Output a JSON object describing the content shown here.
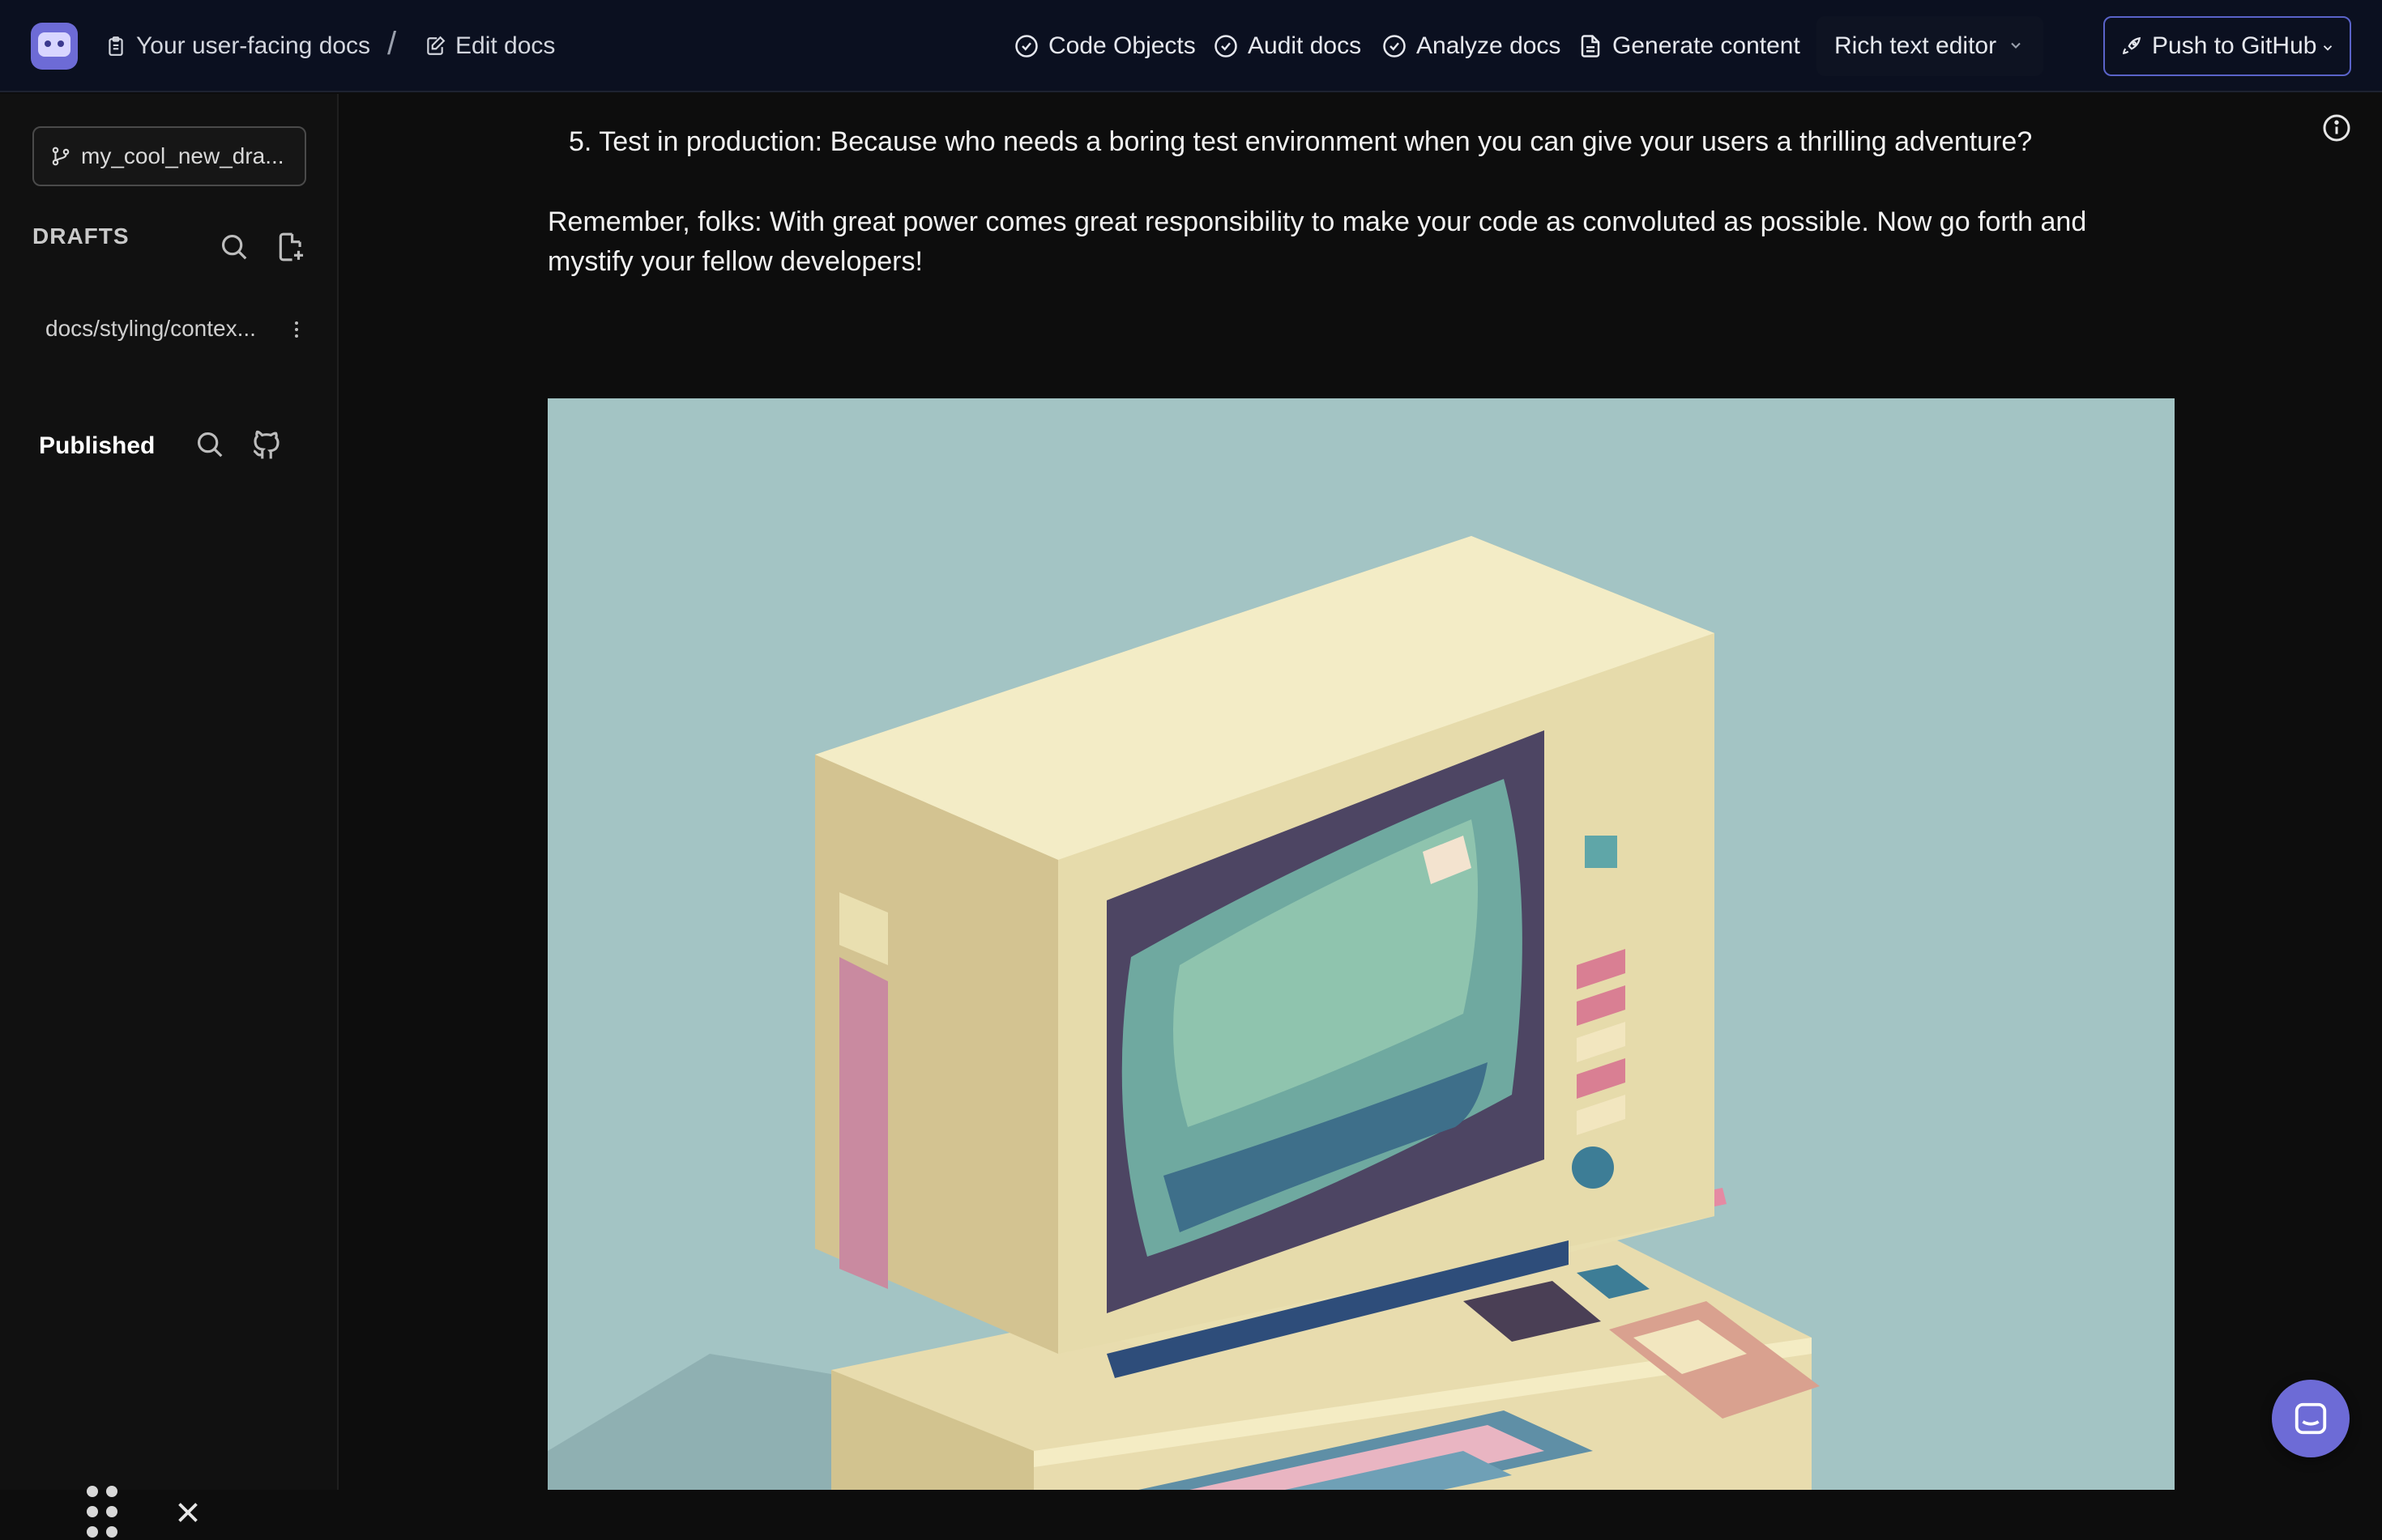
{
  "header": {
    "breadcrumb": {
      "project_label": "Your user-facing docs",
      "separator": "/",
      "page_label": "Edit docs"
    },
    "nav": [
      {
        "label": "Code Objects",
        "icon": "check-circle-icon"
      },
      {
        "label": "Audit docs",
        "icon": "check-circle-icon"
      },
      {
        "label": "Analyze docs",
        "icon": "check-circle-icon"
      },
      {
        "label": "Generate content",
        "icon": "document-icon"
      }
    ],
    "editor_mode": "Rich text editor",
    "push_label": "Push to GitHub"
  },
  "sidebar": {
    "branch": "my_cool_new_dra...",
    "drafts_label": "DRAFTS",
    "drafts": [
      {
        "label": "docs/styling/contex..."
      }
    ],
    "published_label": "Published"
  },
  "content": {
    "list_item": "5. Test in production: Because who needs a boring test environment when you can give your users a thrilling adventure?",
    "paragraph": "Remember, folks: With great power comes great responsibility to make your code as convoluted as possible. Now go forth and mystify your fellow developers!"
  },
  "colors": {
    "accent": "#6d6bd6",
    "topbar_bg": "#0b1020",
    "background": "#0d0d0d",
    "image_bg": "#a3c4c4"
  }
}
